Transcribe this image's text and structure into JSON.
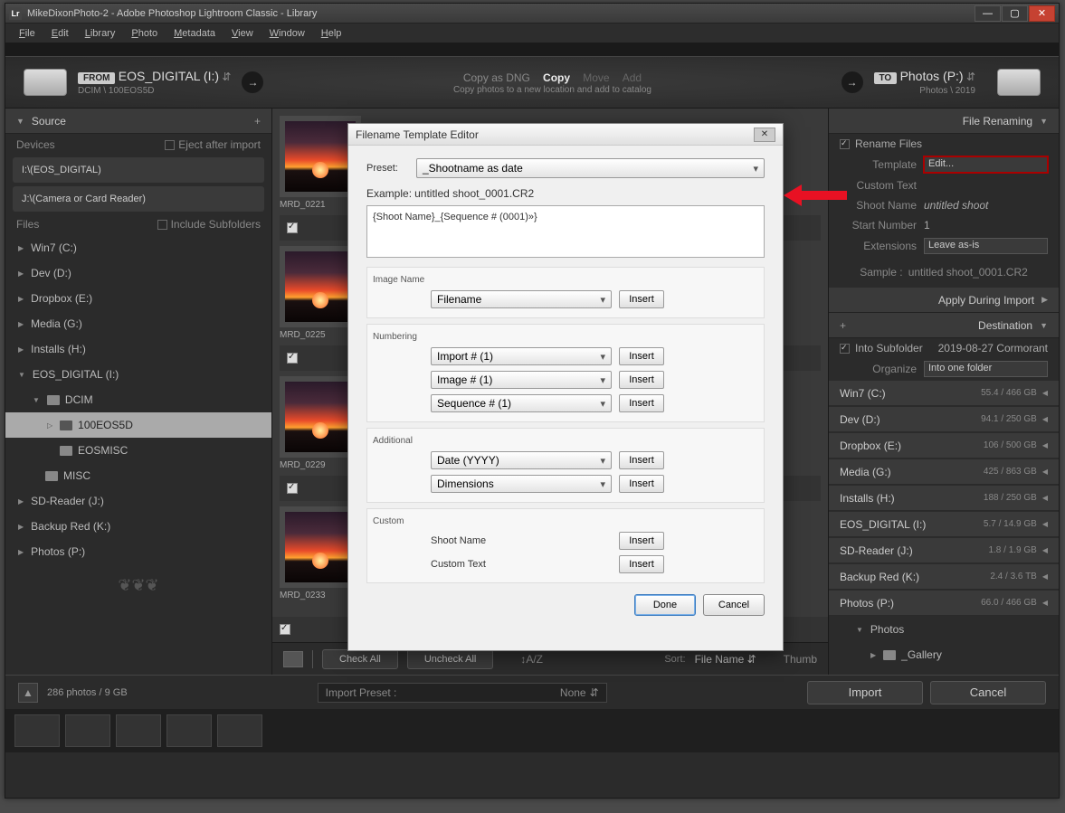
{
  "window": {
    "title": "MikeDixonPhoto-2 - Adobe Photoshop Lightroom Classic - Library",
    "lrIcon": "Lr"
  },
  "menu": [
    "File",
    "Edit",
    "Library",
    "Photo",
    "Metadata",
    "View",
    "Window",
    "Help"
  ],
  "import": {
    "fromBadge": "FROM",
    "fromName": "EOS_DIGITAL (I:)",
    "fromPath": "DCIM \\ 100EOS5D",
    "ops": {
      "dng": "Copy as DNG",
      "copy": "Copy",
      "move": "Move",
      "add": "Add"
    },
    "sub": "Copy photos to a new location and add to catalog",
    "toBadge": "TO",
    "toName": "Photos (P:)",
    "toPath": "Photos \\ 2019"
  },
  "source": {
    "header": "Source",
    "devices": "Devices",
    "eject": "Eject after import",
    "dev1": "I:\\(EOS_DIGITAL)",
    "dev2": "J:\\(Camera or Card Reader)",
    "files": "Files",
    "include": "Include Subfolders",
    "drives": [
      "Win7 (C:)",
      "Dev (D:)",
      "Dropbox (E:)",
      "Media (G:)",
      "Installs (H:)"
    ],
    "eos": "EOS_DIGITAL (I:)",
    "dcim": "DCIM",
    "sel": "100EOS5D",
    "eosmisc": "EOSMISC",
    "misc": "MISC",
    "rest": [
      "SD-Reader (J:)",
      "Backup Red (K:)",
      "Photos (P:)"
    ]
  },
  "thumbs": [
    "MRD_0221",
    "MRD_0225",
    "MRD_0229",
    "MRD_0233"
  ],
  "toolbar": {
    "checkAll": "Check All",
    "uncheckAll": "Uncheck All",
    "sort": "Sort:",
    "sortval": "File Name",
    "thumb": "Thumb"
  },
  "rename": {
    "header": "File Renaming",
    "renameFiles": "Rename Files",
    "template": "Template",
    "templateVal": "Edit...",
    "custom": "Custom Text",
    "shoot": "Shoot Name",
    "shootVal": "untitled shoot",
    "start": "Start Number",
    "startVal": "1",
    "ext": "Extensions",
    "extVal": "Leave as-is",
    "sample": "Sample :",
    "sampleVal": "untitled shoot_0001.CR2"
  },
  "apply": {
    "header": "Apply During Import"
  },
  "dest": {
    "header": "Destination",
    "intoSub": "Into Subfolder",
    "intoSubVal": "2019-08-27 Cormorant",
    "organize": "Organize",
    "organizeVal": "Into one folder",
    "drives": [
      {
        "n": "Win7 (C:)",
        "s": "55.4 / 466 GB"
      },
      {
        "n": "Dev (D:)",
        "s": "94.1 / 250 GB"
      },
      {
        "n": "Dropbox (E:)",
        "s": "106 / 500 GB"
      },
      {
        "n": "Media (G:)",
        "s": "425 / 863 GB"
      },
      {
        "n": "Installs (H:)",
        "s": "188 / 250 GB"
      },
      {
        "n": "EOS_DIGITAL (I:)",
        "s": "5.7 / 14.9 GB"
      },
      {
        "n": "SD-Reader (J:)",
        "s": "1.8 / 1.9 GB"
      },
      {
        "n": "Backup Red (K:)",
        "s": "2.4 / 3.6 TB"
      },
      {
        "n": "Photos (P:)",
        "s": "66.0 / 466 GB"
      }
    ],
    "tree": {
      "photos": "Photos",
      "gallery": "_Gallery"
    }
  },
  "bottom": {
    "count": "286 photos / 9 GB",
    "presetLbl": "Import Preset :",
    "presetVal": "None",
    "import": "Import",
    "cancel": "Cancel"
  },
  "dialog": {
    "title": "Filename Template Editor",
    "preset": "Preset:",
    "presetVal": "_Shootname as date",
    "example": "Example:",
    "exampleVal": "untitled shoot_0001.CR2",
    "token": "{Shoot Name}_{Sequence # (0001)»}",
    "imageName": "Image Name",
    "filename": "Filename",
    "numbering": "Numbering",
    "n1": "Import # (1)",
    "n2": "Image # (1)",
    "n3": "Sequence # (1)",
    "additional": "Additional",
    "a1": "Date (YYYY)",
    "a2": "Dimensions",
    "custom": "Custom",
    "c1": "Shoot Name",
    "c2": "Custom Text",
    "insert": "Insert",
    "done": "Done",
    "cancel": "Cancel"
  }
}
